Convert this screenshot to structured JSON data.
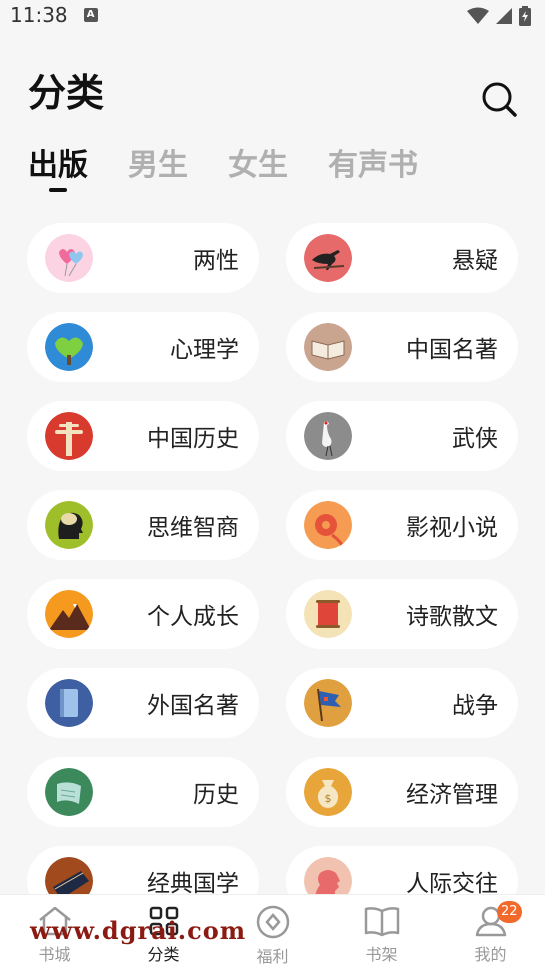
{
  "status": {
    "time": "11:38",
    "indicator": "A"
  },
  "header": {
    "title": "分类"
  },
  "tabs": [
    {
      "label": "出版",
      "active": true
    },
    {
      "label": "男生"
    },
    {
      "label": "女生"
    },
    {
      "label": "有声书"
    }
  ],
  "categories": [
    {
      "label": "两性",
      "icon": "hearts-balloon-icon"
    },
    {
      "label": "悬疑",
      "icon": "crow-icon"
    },
    {
      "label": "心理学",
      "icon": "heart-tree-icon"
    },
    {
      "label": "中国名著",
      "icon": "open-book-icon"
    },
    {
      "label": "中国历史",
      "icon": "pillar-icon"
    },
    {
      "label": "武侠",
      "icon": "crane-icon"
    },
    {
      "label": "思维智商",
      "icon": "brain-head-icon"
    },
    {
      "label": "影视小说",
      "icon": "film-reel-icon"
    },
    {
      "label": "个人成长",
      "icon": "mountain-icon"
    },
    {
      "label": "诗歌散文",
      "icon": "scroll-icon"
    },
    {
      "label": "外国名著",
      "icon": "blue-book-icon"
    },
    {
      "label": "战争",
      "icon": "flag-icon"
    },
    {
      "label": "历史",
      "icon": "parchment-icon"
    },
    {
      "label": "经济管理",
      "icon": "money-bag-icon"
    },
    {
      "label": "经典国学",
      "icon": "bamboo-book-icon"
    },
    {
      "label": "人际交往",
      "icon": "face-profile-icon"
    }
  ],
  "tabbar": {
    "items": [
      {
        "label": "书城",
        "icon": "home-icon"
      },
      {
        "label": "分类",
        "icon": "grid-icon",
        "active": true
      },
      {
        "label": "福利",
        "icon": "coin-icon"
      },
      {
        "label": "书架",
        "icon": "book-icon"
      },
      {
        "label": "我的",
        "icon": "user-icon",
        "badge": "22"
      }
    ]
  },
  "watermark": "www.dgrai.com",
  "colors": {
    "accent": "#f26a2b",
    "text": "#222222",
    "inactive": "#b0b0b0",
    "watermark": "#8b1a12"
  }
}
